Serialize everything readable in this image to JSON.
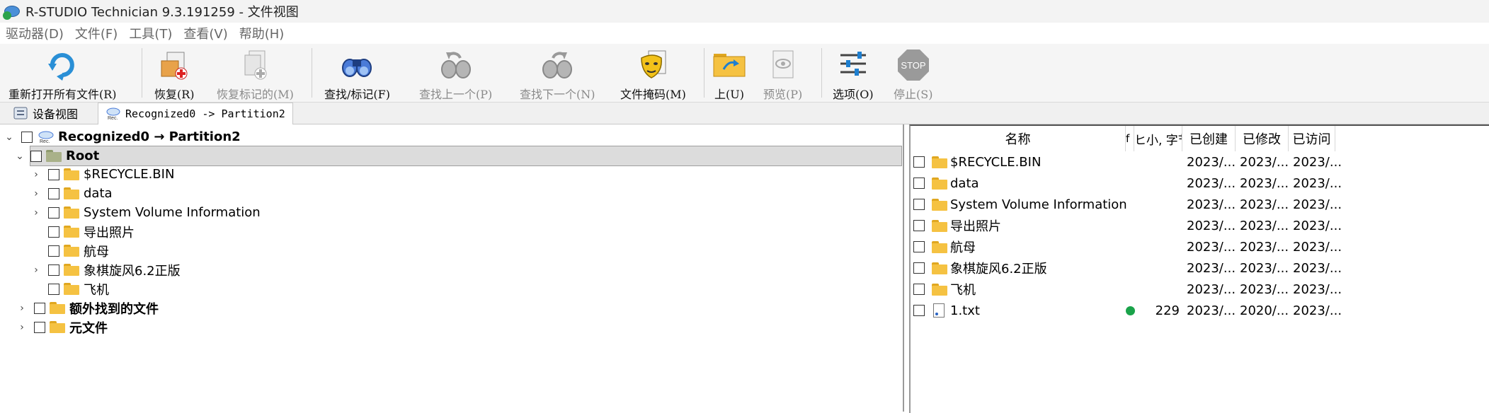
{
  "window": {
    "title": "R-STUDIO Technician 9.3.191259 - 文件视图"
  },
  "menu": [
    "驱动器(D)",
    "文件(F)",
    "工具(T)",
    "查看(V)",
    "帮助(H)"
  ],
  "toolbar": {
    "reopen": "重新打开所有文件(R)",
    "recover": "恢复(R)",
    "recover_marked": "恢复标记的(M)",
    "find_mark": "查找/标记(F)",
    "find_prev": "查找上一个(P)",
    "find_next": "查找下一个(N)",
    "file_mask": "文件掩码(M)",
    "up": "上(U)",
    "preview": "预览(P)",
    "options": "选项(O)",
    "stop": "停止(S)",
    "stop_icon_text": "STOP"
  },
  "tabs": [
    {
      "label": "设备视图"
    },
    {
      "label": "Recognized0 -> Partition2"
    }
  ],
  "icon_texts": {
    "rec": "Rec."
  },
  "tree": {
    "root_node": "Recognized0 → Partition2",
    "root_folder": "Root",
    "items": [
      {
        "label": "$RECYCLE.BIN",
        "expandable": true
      },
      {
        "label": "data",
        "expandable": true
      },
      {
        "label": "System Volume Information",
        "expandable": true
      },
      {
        "label": "导出照片",
        "expandable": false
      },
      {
        "label": "航母",
        "expandable": false
      },
      {
        "label": "象棋旋风6.2正版",
        "expandable": true
      },
      {
        "label": "飞机",
        "expandable": false
      }
    ],
    "extra_found": "额外找到的文件",
    "meta_files": "元文件"
  },
  "list": {
    "columns": [
      "名称",
      "f",
      "ヒ小, 字节",
      "已创建",
      "已修改",
      "已访问"
    ],
    "rows": [
      {
        "name": "$RECYCLE.BIN",
        "size": "",
        "created": "2023/...",
        "modified": "2023/...",
        "accessed": "2023/...",
        "type": "folder"
      },
      {
        "name": "data",
        "size": "",
        "created": "2023/...",
        "modified": "2023/...",
        "accessed": "2023/...",
        "type": "folder"
      },
      {
        "name": "System Volume Information",
        "size": "",
        "created": "2023/...",
        "modified": "2023/...",
        "accessed": "2023/...",
        "type": "folder"
      },
      {
        "name": "导出照片",
        "size": "",
        "created": "2023/...",
        "modified": "2023/...",
        "accessed": "2023/...",
        "type": "folder"
      },
      {
        "name": "航母",
        "size": "",
        "created": "2023/...",
        "modified": "2023/...",
        "accessed": "2023/...",
        "type": "folder"
      },
      {
        "name": "象棋旋风6.2正版",
        "size": "",
        "created": "2023/...",
        "modified": "2023/...",
        "accessed": "2023/...",
        "type": "folder"
      },
      {
        "name": "飞机",
        "size": "",
        "created": "2023/...",
        "modified": "2023/...",
        "accessed": "2023/...",
        "type": "folder"
      },
      {
        "name": "1.txt",
        "size": "229",
        "created": "2023/...",
        "modified": "2020/...",
        "accessed": "2023/...",
        "type": "file"
      }
    ]
  },
  "colors": {
    "folder": "#f5c242",
    "status_green": "#1aa34a"
  }
}
